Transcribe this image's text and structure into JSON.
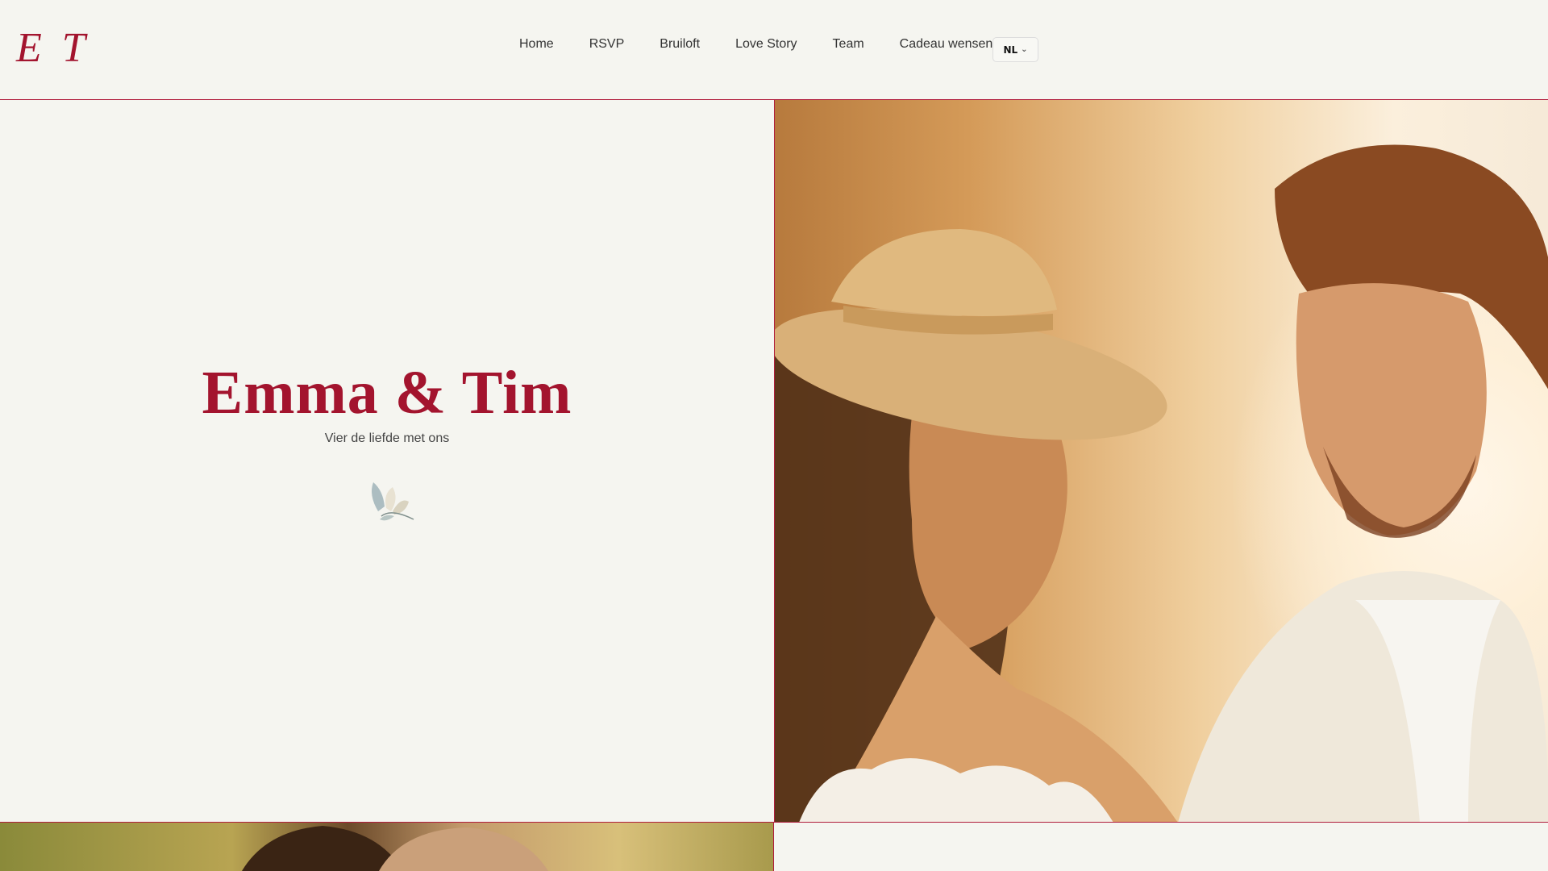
{
  "header": {
    "logo": "E T",
    "nav": [
      {
        "label": "Home"
      },
      {
        "label": "RSVP"
      },
      {
        "label": "Bruiloft"
      },
      {
        "label": "Love Story"
      },
      {
        "label": "Team"
      },
      {
        "label": "Cadeau wensen"
      }
    ],
    "language": "NL"
  },
  "hero": {
    "title": "Emma & Tim",
    "subtitle": "Vier de liefde met ons"
  },
  "colors": {
    "accent": "#a3142e",
    "background": "#f5f5f0"
  }
}
